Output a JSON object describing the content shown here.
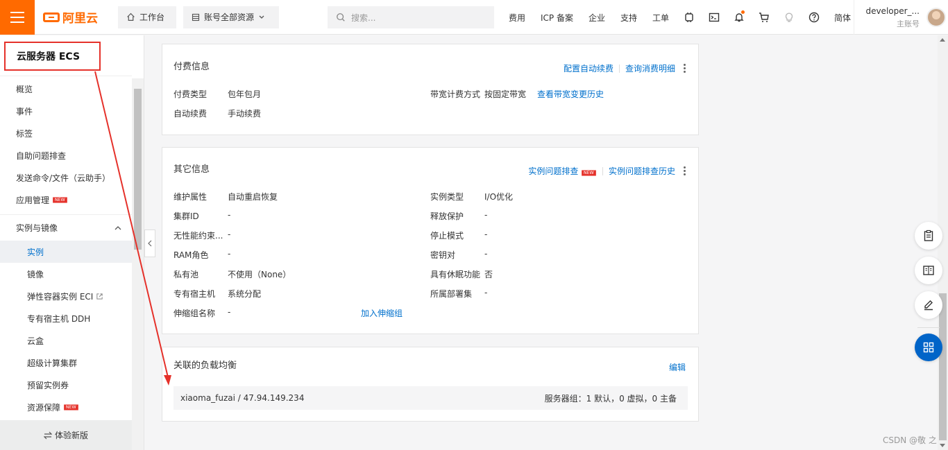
{
  "header": {
    "brand": "阿里云",
    "workbench": "工作台",
    "resource_scope": "账号全部资源",
    "search_placeholder": "搜索...",
    "links": [
      "费用",
      "ICP 备案",
      "企业",
      "支持",
      "工单"
    ],
    "lang": "简体",
    "user_name": "developer_...",
    "user_sub": "主账号"
  },
  "sidebar": {
    "title": "云服务器 ECS",
    "items": [
      "概览",
      "事件",
      "标签",
      "自助问题排查",
      "发送命令/文件（云助手）",
      "应用管理"
    ],
    "new_badge": "NEW",
    "group": "实例与镜像",
    "sub_items": [
      "实例",
      "镜像",
      "弹性容器实例 ECI",
      "专有宿主机 DDH",
      "云盒",
      "超级计算集群",
      "预留实例券",
      "资源保障"
    ],
    "footer": "体验新版"
  },
  "billing": {
    "title": "付费信息",
    "action1": "配置自动续费",
    "action2": "查询消费明细",
    "pay_type_k": "付费类型",
    "pay_type_v": "包年包月",
    "bw_k": "带宽计费方式",
    "bw_v": "按固定带宽",
    "bw_link": "查看带宽变更历史",
    "renew_k": "自动续费",
    "renew_v": "手动续费"
  },
  "other": {
    "title": "其它信息",
    "action1": "实例问题排查",
    "action2": "实例问题排查历史",
    "rows_left": [
      {
        "k": "维护属性",
        "v": "自动重启恢复"
      },
      {
        "k": "集群ID",
        "v": "-"
      },
      {
        "k": "无性能约束...",
        "v": "-"
      },
      {
        "k": "RAM角色",
        "v": "-"
      },
      {
        "k": "私有池",
        "v": "不使用（None）"
      },
      {
        "k": "专有宿主机",
        "v": "系统分配"
      },
      {
        "k": "伸缩组名称",
        "v": "-"
      }
    ],
    "rows_right": [
      {
        "k": "实例类型",
        "v": "I/O优化"
      },
      {
        "k": "释放保护",
        "v": "-"
      },
      {
        "k": "停止模式",
        "v": "-"
      },
      {
        "k": "密钥对",
        "v": "-"
      },
      {
        "k": "具有休眠功能",
        "v": "否"
      },
      {
        "k": "所属部署集",
        "v": "-"
      }
    ],
    "scaling_link": "加入伸缩组"
  },
  "lb": {
    "title": "关联的负载均衡",
    "edit": "编辑",
    "name": "xiaoma_fuzai / 47.94.149.234",
    "servers": "服务器组：1 默认，0 虚拟，0 主备"
  },
  "watermark": "CSDN @敬 之",
  "colors": {
    "brand": "#ff6a00",
    "link": "#0070cc",
    "annotation": "#e5312a",
    "primary": "#0064c8"
  }
}
